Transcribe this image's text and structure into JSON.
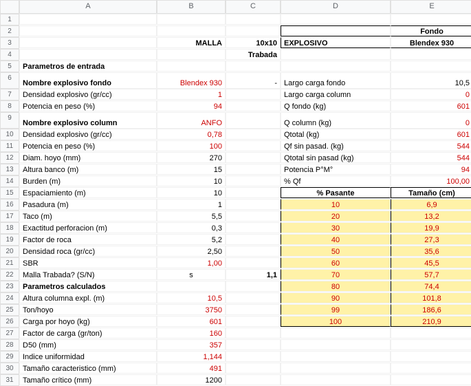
{
  "columns": [
    "A",
    "B",
    "C",
    "D",
    "E"
  ],
  "rows": [
    "1",
    "2",
    "3",
    "4",
    "5",
    "6",
    "7",
    "8",
    "9",
    "10",
    "11",
    "12",
    "13",
    "14",
    "15",
    "16",
    "17",
    "18",
    "19",
    "20",
    "21",
    "22",
    "23",
    "24",
    "25",
    "26",
    "27",
    "28",
    "29",
    "30",
    "31"
  ],
  "r3": {
    "b": "MALLA",
    "c": "10x10",
    "d": "EXPLOSIVO",
    "e_top": "Fondo",
    "e": "Blendex 930"
  },
  "r4": {
    "c": "Trabada"
  },
  "r5": {
    "a": "Parametros de entrada"
  },
  "r6": {
    "a": "Nombre explosivo fondo",
    "b": "Blendex 930",
    "c": "-",
    "d": "Largo carga fondo",
    "e": "10,5"
  },
  "r7": {
    "a": "Densidad explosivo (gr/cc)",
    "b": "1",
    "d": "Largo carga column",
    "e": "0"
  },
  "r8": {
    "a": "Potencia en peso (%)",
    "b": "94",
    "d": "Q fondo (kg)",
    "e": "601"
  },
  "r9": {
    "a": "Nombre explosivo column",
    "b": "ANFO",
    "d": "Q column (kg)",
    "e": "0"
  },
  "r10": {
    "a": "Densidad explosivo (gr/cc)",
    "b": "0,78",
    "d": "Qtotal (kg)",
    "e": "601"
  },
  "r11": {
    "a": "Potencia en peso (%)",
    "b": "100",
    "d": "Qf sin pasad. (kg)",
    "e": "544"
  },
  "r12": {
    "a": "Diam. hoyo (mm)",
    "b": "270",
    "d": "Qtotal sin pasad (kg)",
    "e": "544"
  },
  "r13": {
    "a": "Altura banco (m)",
    "b": "15",
    "d": "Potencia P°M°",
    "e": "94"
  },
  "r14": {
    "a": "Burden (m)",
    "b": "10",
    "d": "% Qf",
    "e": "100,00"
  },
  "r15": {
    "a": "Espaciamiento (m)",
    "b": "10",
    "d": "% Pasante",
    "e": "Tamaño (cm)"
  },
  "r16": {
    "a": "Pasadura (m)",
    "b": "1",
    "d": "10",
    "e": "6,9"
  },
  "r17": {
    "a": "Taco (m)",
    "b": "5,5",
    "d": "20",
    "e": "13,2"
  },
  "r18": {
    "a": "Exactitud perforacion (m)",
    "b": "0,3",
    "d": "30",
    "e": "19,9"
  },
  "r19": {
    "a": "Factor de roca",
    "b": "5,2",
    "d": "40",
    "e": "27,3"
  },
  "r20": {
    "a": "Densidad roca (gr/cc)",
    "b": "2,50",
    "d": "50",
    "e": "35,6"
  },
  "r21": {
    "a": "SBR",
    "b": "1,00",
    "d": "60",
    "e": "45,5"
  },
  "r22": {
    "a": "Malla Trabada? (S/N)",
    "b": "s",
    "c": "1,1",
    "d": "70",
    "e": "57,7"
  },
  "r23": {
    "a": "Parametros calculados",
    "d": "80",
    "e": "74,4"
  },
  "r24": {
    "a": "Altura columna expl. (m)",
    "b": "10,5",
    "d": "90",
    "e": "101,8"
  },
  "r25": {
    "a": "Ton/hoyo",
    "b": "3750",
    "d": "99",
    "e": "186,6"
  },
  "r26": {
    "a": "Carga por hoyo (kg)",
    "b": "601",
    "d": "100",
    "e": "210,9"
  },
  "r27": {
    "a": "Factor de carga (gr/ton)",
    "b": "160"
  },
  "r28": {
    "a": "D50 (mm)",
    "b": "357"
  },
  "r29": {
    "a": "Indice uniformidad",
    "b": "1,144"
  },
  "r30": {
    "a": "Tamaño caracteristico (mm)",
    "b": "491"
  },
  "r31": {
    "a": "Tamaño crítico (mm)",
    "b": "1200"
  },
  "chart_data": {
    "type": "table",
    "title": "% Pasante vs Tamaño (cm)",
    "columns": [
      "% Pasante",
      "Tamaño (cm)"
    ],
    "rows": [
      [
        10,
        6.9
      ],
      [
        20,
        13.2
      ],
      [
        30,
        19.9
      ],
      [
        40,
        27.3
      ],
      [
        50,
        35.6
      ],
      [
        60,
        45.5
      ],
      [
        70,
        57.7
      ],
      [
        80,
        74.4
      ],
      [
        90,
        101.8
      ],
      [
        99,
        186.6
      ],
      [
        100,
        210.9
      ]
    ]
  }
}
